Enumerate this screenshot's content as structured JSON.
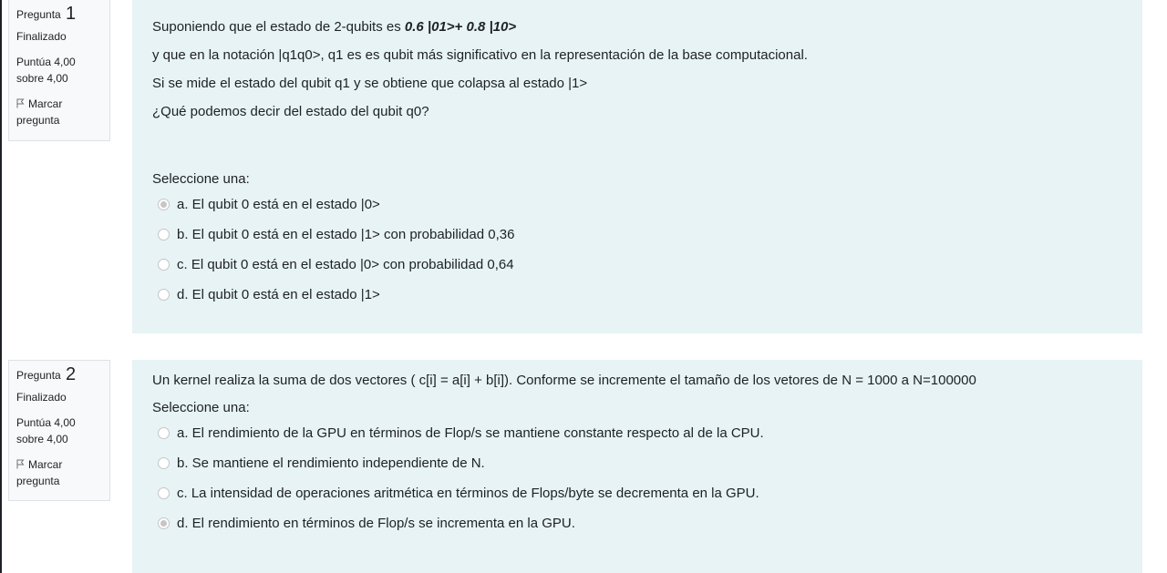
{
  "questions": [
    {
      "label": "Pregunta",
      "number": "1",
      "state": "Finalizado",
      "grade_line1": "Puntúa 4,00",
      "grade_line2": "sobre 4,00",
      "flag_line1": "Marcar",
      "flag_line2": "pregunta",
      "text_intro": "Suponiendo que el estado de 2-qubits  es  ",
      "text_state": "0.6 |01>+ 0.8 |10>",
      "text_line2": "y que en la notación |q1q0>,  q1 es es qubit más significativo en la representación de la base computacional.",
      "text_line3": "Si se mide el estado del qubit q1 y se obtiene que colapsa al estado |1>",
      "text_line4": "¿Qué podemos decir del estado del qubit q0?",
      "prompt": "Seleccione una:",
      "options": [
        {
          "label": "a. El qubit 0 está en el estado |0>",
          "selected": true
        },
        {
          "label": "b. El qubit 0 está en el estado |1> con probabilidad 0,36",
          "selected": false
        },
        {
          "label": "c. El qubit 0 está en el estado |0> con probabilidad 0,64",
          "selected": false
        },
        {
          "label": "d. El qubit 0 está en el estado |1>",
          "selected": false
        }
      ]
    },
    {
      "label": "Pregunta",
      "number": "2",
      "state": "Finalizado",
      "grade_line1": "Puntúa 4,00",
      "grade_line2": "sobre 4,00",
      "flag_line1": "Marcar",
      "flag_line2": "pregunta",
      "text_line1": "Un kernel realiza la suma de dos vectores ( c[i] = a[i] + b[i]). Conforme se incremente el tamaño de los vetores de N = 1000 a N=100000",
      "prompt": "Seleccione una:",
      "options": [
        {
          "label": "a. El rendimiento de la GPU en términos de Flop/s se mantiene constante respecto al de la CPU.",
          "selected": false
        },
        {
          "label": "b. Se mantiene el rendimiento independiente de N.",
          "selected": false
        },
        {
          "label": "c. La intensidad de operaciones aritmética en términos de Flops/byte se decrementa en la GPU.",
          "selected": false
        },
        {
          "label": "d. El rendimiento en términos de Flop/s se incrementa en la GPU.",
          "selected": true
        }
      ]
    }
  ],
  "icons": {
    "flag": "flag-icon",
    "radio": "radio-button"
  },
  "colors": {
    "content_bg": "#e7f3f5",
    "info_bg": "#f8f9fa",
    "text": "#1d2125",
    "radio_border": "#c6c6c6"
  }
}
